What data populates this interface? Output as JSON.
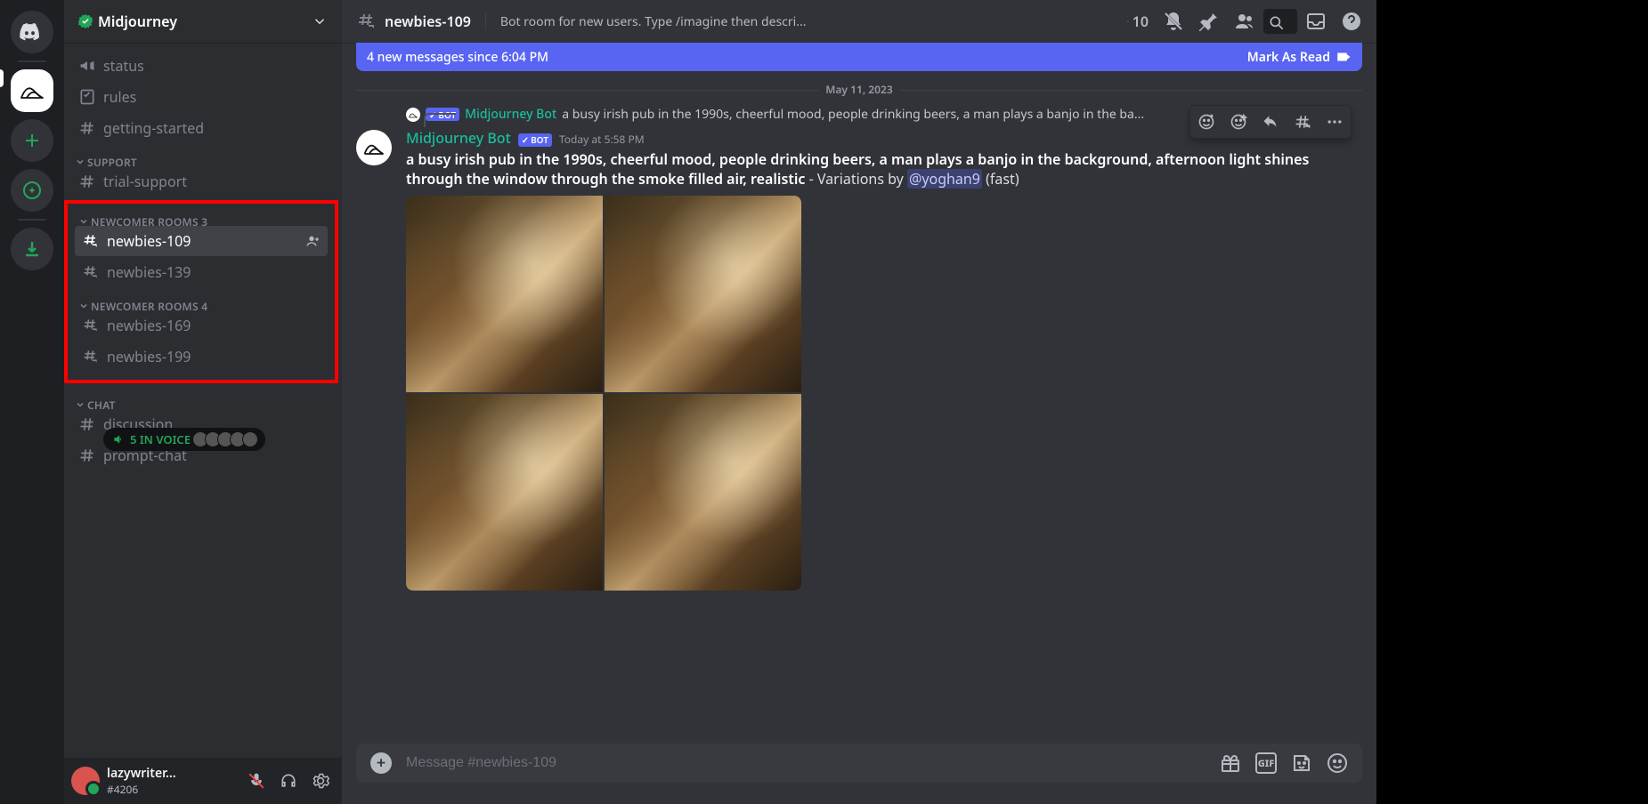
{
  "server_rail": {
    "home_tooltip": "Direct Messages",
    "active_server": "Midjourney",
    "add_label": "Add a Server",
    "explore_label": "Explore",
    "download_label": "Download Apps"
  },
  "server_header": {
    "name": "Midjourney",
    "verified": true
  },
  "channels": {
    "top": [
      {
        "icon": "announce",
        "name": "status"
      },
      {
        "icon": "rules",
        "name": "rules"
      },
      {
        "icon": "hash",
        "name": "getting-started"
      }
    ],
    "support_category": "SUPPORT",
    "support": [
      {
        "icon": "hash",
        "name": "trial-support"
      }
    ],
    "newcomer3_category": "NEWCOMER ROOMS 3",
    "newcomer3": [
      {
        "icon": "thread",
        "name": "newbies-109",
        "selected": true
      },
      {
        "icon": "thread",
        "name": "newbies-139"
      }
    ],
    "newcomer4_category": "NEWCOMER ROOMS 4",
    "newcomer4": [
      {
        "icon": "thread",
        "name": "newbies-169"
      },
      {
        "icon": "thread",
        "name": "newbies-199"
      }
    ],
    "chat_category": "CHAT",
    "chat": [
      {
        "icon": "hash",
        "name": "discussion"
      },
      {
        "icon": "hash",
        "name": "prompt-chat"
      }
    ]
  },
  "voice_pill": {
    "count": "5 IN VOICE",
    "avatars": 5
  },
  "user_panel": {
    "name": "lazywriter...",
    "tag": "#4206"
  },
  "chat_header": {
    "channel": "newbies-109",
    "topic": "Bot room for new users. Type /imagine then descri...",
    "threads_count": "10",
    "search_placeholder": "Search"
  },
  "new_msg_bar": {
    "text": "4 new messages since 6:04 PM",
    "mark": "Mark As Read"
  },
  "date_divider": "May 11, 2023",
  "reply_ref": {
    "bot_label": "BOT",
    "name": "Midjourney Bot",
    "text": "a busy irish pub in the 1990s, cheerful mood, people drinking beers, a man plays a banjo in the ba..."
  },
  "message": {
    "author": "Midjourney Bot",
    "bot_label": "BOT",
    "timestamp": "Today at 5:58 PM",
    "prompt_bold": "a busy irish pub in the 1990s, cheerful mood, people drinking beers, a man plays a banjo in the background, afternoon light shines through the window through the smoke filled air, realistic",
    "suffix": " - Variations by ",
    "mention": "@yoghan9",
    "tail": " (fast)"
  },
  "chat_input": {
    "placeholder": "Message #newbies-109",
    "gif_label": "GIF"
  }
}
